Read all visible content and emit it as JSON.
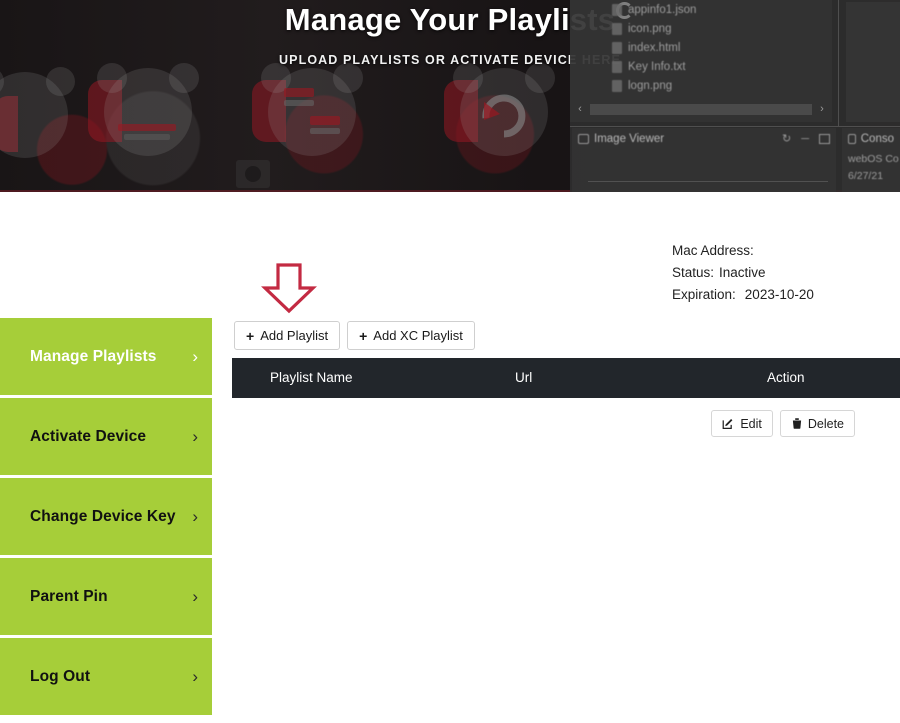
{
  "banner": {
    "title": "Manage Your Playlists",
    "subtitle": "UPLOAD PLAYLISTS OR ACTIVATE DEVICE HERE"
  },
  "ide_overlay": {
    "files": [
      "appinfo1.json",
      "icon.png",
      "index.html",
      "Key Info.txt",
      "logn.png"
    ],
    "scroll_left": "‹",
    "scroll_right": "›",
    "image_viewer_title": "Image Viewer",
    "console_title": "Conso",
    "console_line1": "webOS Co",
    "console_line2": "6/27/21"
  },
  "sidebar": {
    "items": [
      {
        "label": "Manage Playlists",
        "chevron": "›",
        "active": true
      },
      {
        "label": "Activate Device",
        "chevron": "›",
        "active": false
      },
      {
        "label": "Change Device Key",
        "chevron": "›",
        "active": false
      },
      {
        "label": "Parent Pin",
        "chevron": "›",
        "active": false
      },
      {
        "label": "Log Out",
        "chevron": "›",
        "active": false
      }
    ]
  },
  "device_info": {
    "mac_label": "Mac Address:",
    "mac_value": "",
    "status_label": "Status:",
    "status_value": "Inactive",
    "expiration_label": "Expiration:",
    "expiration_value": "2023-10-20"
  },
  "toolbar": {
    "add_playlist_label": "Add Playlist",
    "add_xc_playlist_label": "Add XC Playlist",
    "plus": "+"
  },
  "table": {
    "columns": {
      "name": "Playlist Name",
      "url": "Url",
      "action": "Action"
    },
    "rows": [
      {
        "name": "",
        "url": "",
        "edit_label": "Edit",
        "delete_label": "Delete"
      }
    ]
  },
  "colors": {
    "sidebar_green": "#a6ce39",
    "table_header": "#22262b",
    "banner_dark": "#1b1718",
    "annotation_red": "#c32a42"
  }
}
